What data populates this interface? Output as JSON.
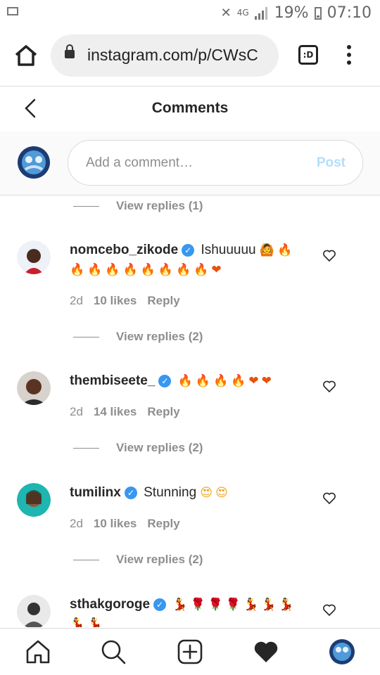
{
  "status_bar": {
    "network": "4G",
    "battery": "19%",
    "time": "07:10"
  },
  "browser": {
    "url": "instagram.com/p/CWsC",
    "tabs_label": ":D"
  },
  "header": {
    "title": "Comments"
  },
  "composer": {
    "placeholder": "Add a comment…",
    "post_label": "Post"
  },
  "top_view_replies": "View replies (1)",
  "comments": [
    {
      "username": "nomcebo_zikode",
      "verified": true,
      "text": "Ishuuuuu",
      "emoji_line1": "🙆🔥",
      "emoji_line2": "🔥🔥🔥🔥🔥🔥🔥🔥❤",
      "age": "2d",
      "likes": "10 likes",
      "reply": "Reply",
      "view_replies": "View replies (2)"
    },
    {
      "username": "thembiseete_",
      "verified": true,
      "text": "",
      "emoji_line1": "🔥🔥🔥🔥❤❤",
      "age": "2d",
      "likes": "14 likes",
      "reply": "Reply",
      "view_replies": "View replies (2)"
    },
    {
      "username": "tumilinx",
      "verified": true,
      "text": "Stunning",
      "emoji_line1": "😍😍",
      "age": "2d",
      "likes": "10 likes",
      "reply": "Reply",
      "view_replies": "View replies (2)"
    },
    {
      "username": "sthakgoroge",
      "verified": true,
      "text": "",
      "emoji_line1": "💃🌹🌹🌹💃💃💃",
      "emoji_line2": "💃💃"
    }
  ],
  "colors": {
    "accent": "#3897f0",
    "post_disabled": "#b2dffc",
    "muted": "#8e8e8e"
  }
}
